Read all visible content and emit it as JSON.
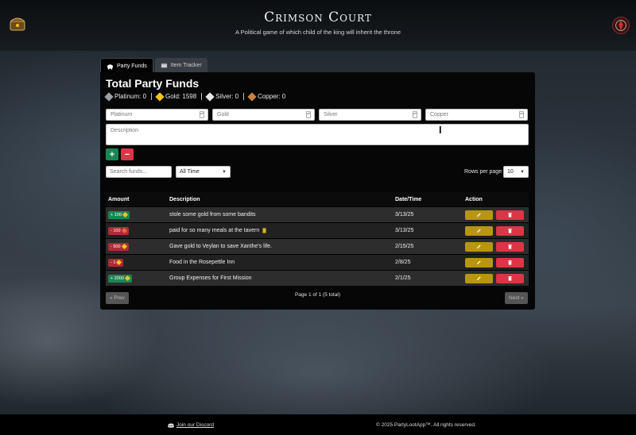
{
  "header": {
    "title": "Crimson Court",
    "subtitle": "A Political game of which child of the king will inherit the throne"
  },
  "tabs": [
    {
      "label": "Party Funds",
      "active": true
    },
    {
      "label": "Item Tracker",
      "active": false
    }
  ],
  "funds": {
    "title": "Total Party Funds",
    "balances": [
      {
        "name": "Platinum",
        "text": "Platinum: 0"
      },
      {
        "name": "Gold",
        "text": "Gold: 1598"
      },
      {
        "name": "Silver",
        "text": "Silver: 0"
      },
      {
        "name": "Copper",
        "text": "Copper: 0"
      }
    ]
  },
  "form": {
    "platinum_placeholder": "Platinum",
    "gold_placeholder": "Gold",
    "silver_placeholder": "Silver",
    "copper_placeholder": "Copper",
    "description_placeholder": "Description",
    "add_label": "+",
    "subtract_label": "−"
  },
  "filters": {
    "search_placeholder": "Search funds...",
    "period_value": "All Time",
    "rows_label": "Rows per page",
    "rows_value": "10"
  },
  "table": {
    "headers": [
      "Amount",
      "Description",
      "Date/Time",
      "Action"
    ],
    "rows": [
      {
        "amount": "+ 100",
        "kind": "pos",
        "coin": "gold",
        "description": "stole some gold from some bandits",
        "date": "3/13/25",
        "note": false
      },
      {
        "amount": "- 100",
        "kind": "neg",
        "coin": "copper",
        "description": "paid for so many meals at the tavern",
        "date": "3/13/25",
        "note": true
      },
      {
        "amount": "- 500",
        "kind": "neg",
        "coin": "gold",
        "description": "Gave gold to Veylan to save Xanthe's life.",
        "date": "2/15/25",
        "note": false
      },
      {
        "amount": "- 1",
        "kind": "neg",
        "coin": "gold",
        "description": "Food in the Rosepettle Inn",
        "date": "2/8/25",
        "note": false
      },
      {
        "amount": "+ 2000",
        "kind": "pos",
        "coin": "gold",
        "description": "Group Expenses for First Mission",
        "date": "2/1/25",
        "note": false
      }
    ]
  },
  "pagination": {
    "prev_label": "« Prev",
    "next_label": "Next »",
    "info": "Page 1 of 1 (5 total)"
  },
  "footer": {
    "discord_label": "Join our Discord",
    "copyright": "© 2025 PartyLootApp™. All rights reserved."
  },
  "colors": {
    "success": "#198754",
    "danger": "#dc3545",
    "warning": "#b8960f",
    "gold_coin": "#f5c518"
  }
}
